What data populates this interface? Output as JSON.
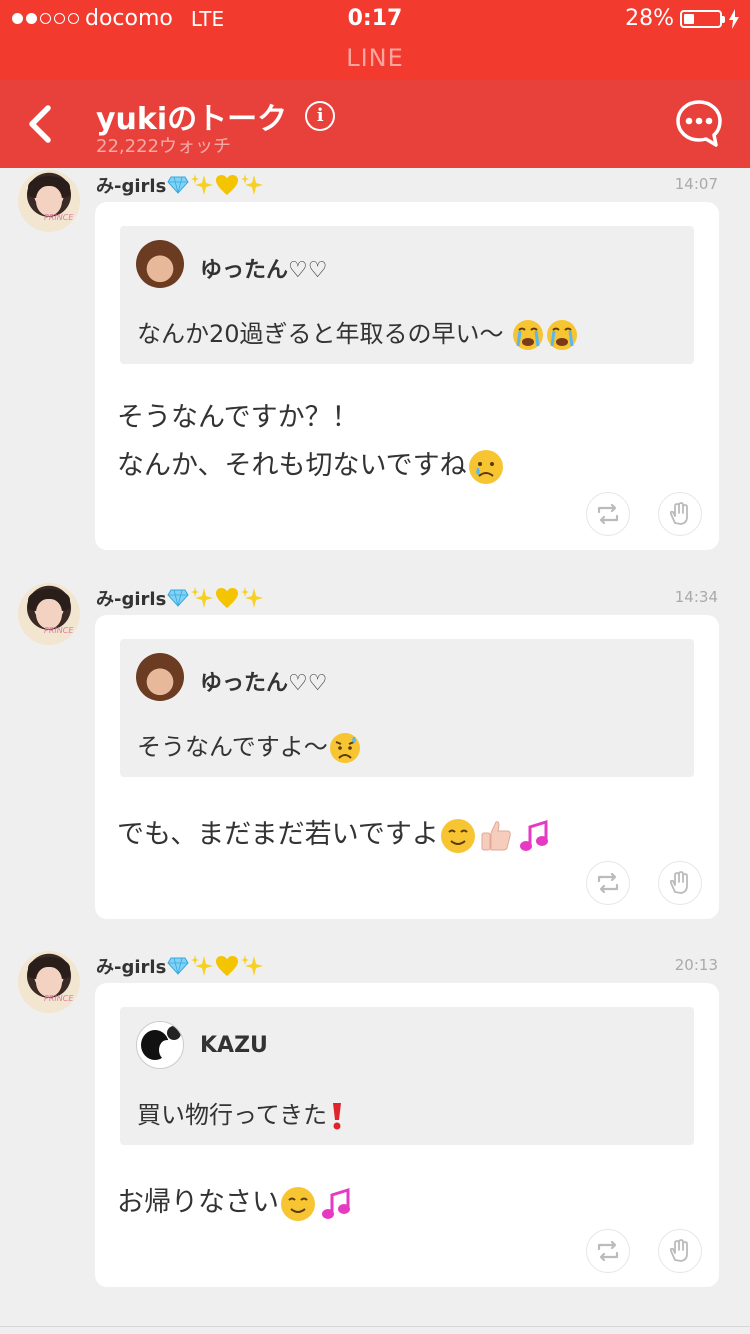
{
  "status_bar": {
    "carrier": "docomo",
    "network": "LTE",
    "time": "0:17",
    "battery": "28%",
    "battery_level": 0.28
  },
  "app_name": "LINE",
  "header": {
    "title": "yukiのトーク",
    "subtitle": "22,222ウォッチ",
    "info_label": "i"
  },
  "posts": [
    {
      "user": "み-girls",
      "time": "14:07",
      "quote": {
        "name": "ゆったん♡♡",
        "text": "なんか20過ぎると年取るの早い〜"
      },
      "lines": [
        "そうなんですか？！",
        "なんか、それも切ないですね"
      ]
    },
    {
      "user": "み-girls",
      "time": "14:34",
      "quote": {
        "name": "ゆったん♡♡",
        "text": "そうなんですよ〜"
      },
      "lines": [
        "でも、まだまだ若いですよ"
      ]
    },
    {
      "user": "み-girls",
      "time": "20:13",
      "quote": {
        "name": "KAZU",
        "text": "買い物行ってきた"
      },
      "lines": [
        "お帰りなさい"
      ]
    }
  ],
  "colors": {
    "status_bar": "#f33a2e",
    "header": "#e8403a",
    "background": "#efefef"
  },
  "icons": [
    "back-arrow-icon",
    "info-icon",
    "chat-bubble-icon",
    "share-icon",
    "clap-icon",
    "diamond-emoji",
    "sparkles-emoji",
    "yellow-heart-emoji",
    "crying-emoji",
    "sad-emoji",
    "smile-emoji",
    "thumbs-up-emoji",
    "music-note-emoji",
    "exclamation-emoji"
  ]
}
